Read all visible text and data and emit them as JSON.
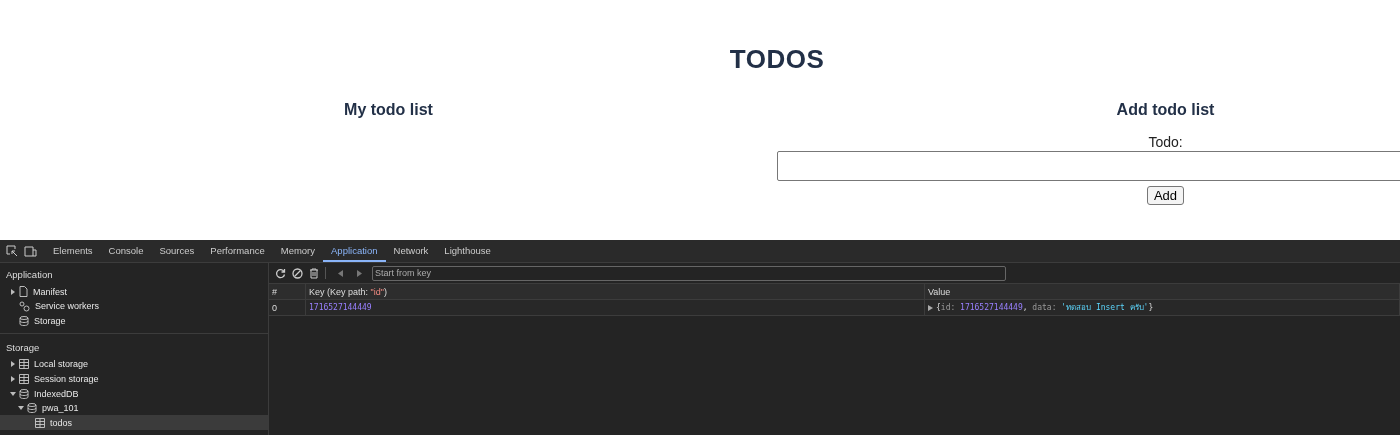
{
  "page": {
    "title": "TODOS",
    "list_heading": "My todo list",
    "form_heading": "Add todo list",
    "field_label": "Todo:",
    "button": "Add"
  },
  "devtools": {
    "tabs": [
      {
        "label": "Elements",
        "selected": false
      },
      {
        "label": "Console",
        "selected": false
      },
      {
        "label": "Sources",
        "selected": false
      },
      {
        "label": "Performance",
        "selected": false
      },
      {
        "label": "Memory",
        "selected": false
      },
      {
        "label": "Application",
        "selected": true
      },
      {
        "label": "Network",
        "selected": false
      },
      {
        "label": "Lighthouse",
        "selected": false
      }
    ],
    "sidebar": [
      {
        "heading": "Application",
        "items": [
          {
            "label": "Manifest",
            "kind": "file",
            "expanded": false,
            "selected": false
          },
          {
            "label": "Service workers",
            "kind": "gears",
            "selected": false
          },
          {
            "label": "Storage",
            "kind": "db",
            "selected": false
          }
        ]
      },
      {
        "heading": "Storage",
        "items": [
          {
            "label": "Local storage",
            "kind": "table",
            "expanded": false,
            "selected": false
          },
          {
            "label": "Session storage",
            "kind": "table",
            "expanded": false,
            "selected": false
          },
          {
            "label": "IndexedDB",
            "kind": "db",
            "expanded": true,
            "selected": false,
            "children": [
              {
                "label": "pwa_101",
                "kind": "db",
                "expanded": true,
                "selected": false,
                "children": [
                  {
                    "label": "todos",
                    "kind": "table",
                    "selected": true
                  }
                ]
              }
            ]
          }
        ]
      }
    ],
    "search": {
      "placeholder": "Start from key"
    },
    "columns": [
      {
        "tokens": [
          {
            "kind": "plain",
            "text": "#"
          }
        ]
      },
      {
        "tokens": [
          {
            "kind": "plain",
            "text": "Key (Key path: "
          },
          {
            "kind": "string-key",
            "text": "\"id\""
          },
          {
            "kind": "plain",
            "text": ")"
          }
        ]
      },
      {
        "tokens": [
          {
            "kind": "plain",
            "text": "Value"
          }
        ]
      }
    ],
    "rows": [
      {
        "index": "0",
        "key": "1716527144449",
        "value": [
          {
            "kind": "punct",
            "text": "{"
          },
          {
            "kind": "key",
            "text": "id: "
          },
          {
            "kind": "number",
            "text": "1716527144449"
          },
          {
            "kind": "punct",
            "text": ", "
          },
          {
            "kind": "key",
            "text": "data: "
          },
          {
            "kind": "string",
            "text": "'ทดสอบ Insert ครับ'"
          },
          {
            "kind": "punct",
            "text": "}"
          }
        ]
      }
    ]
  }
}
